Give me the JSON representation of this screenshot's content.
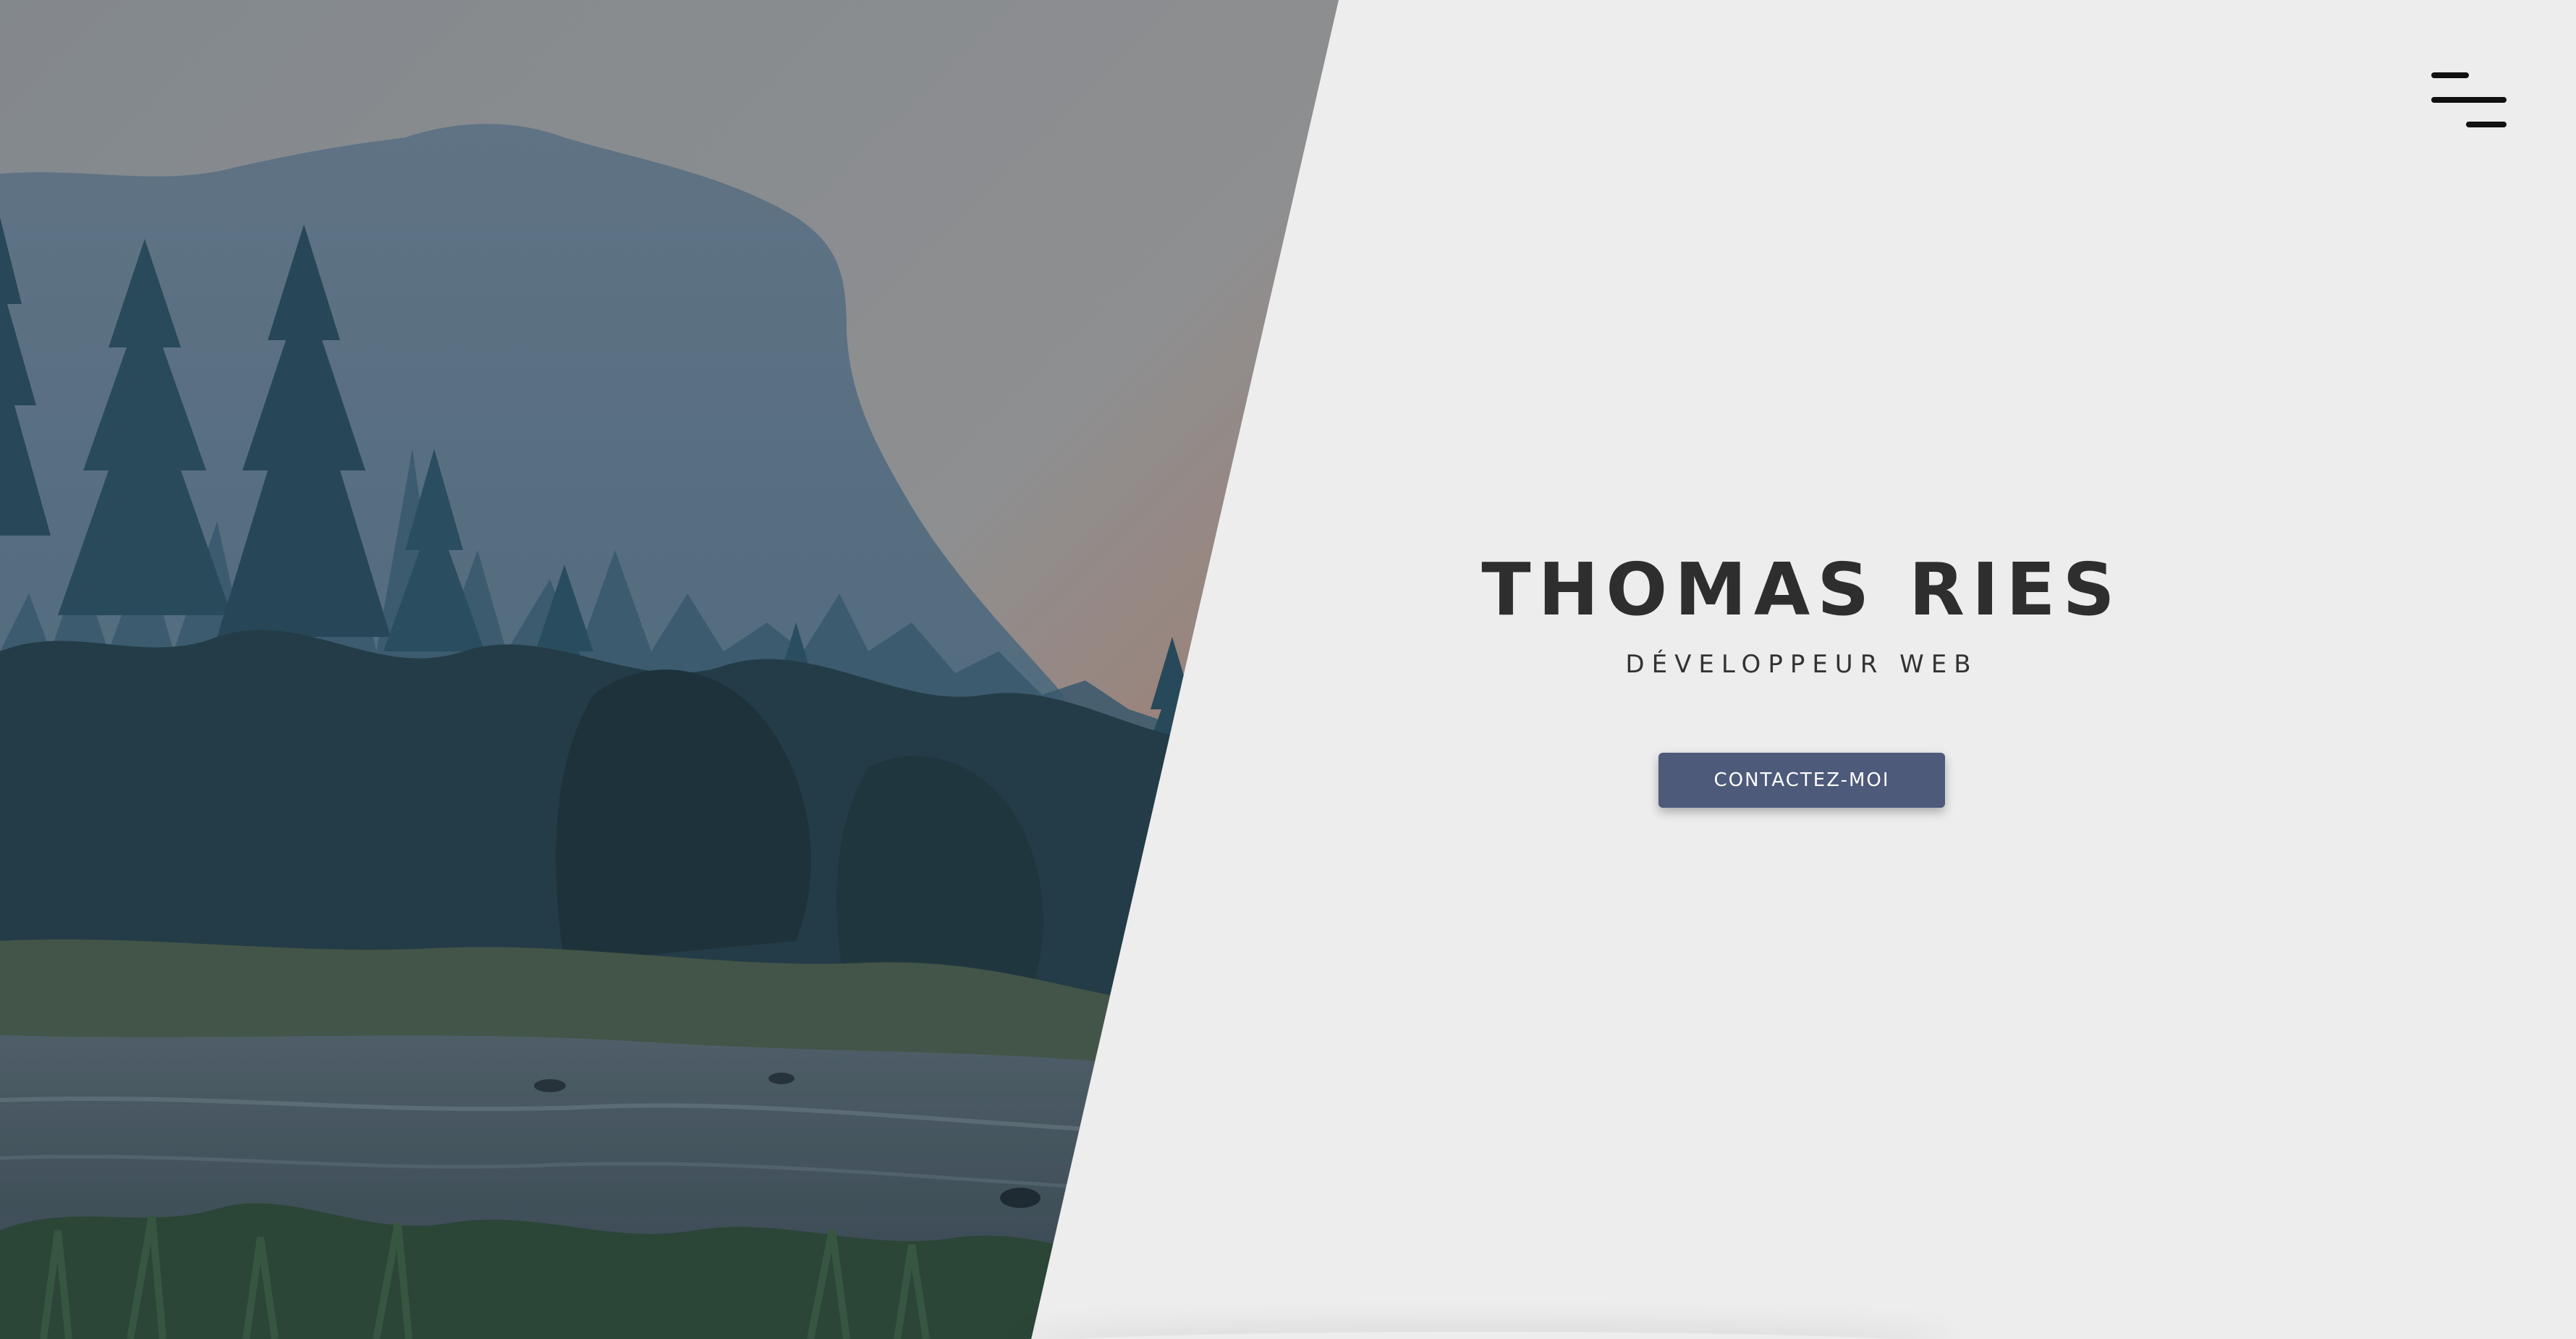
{
  "hero": {
    "name": "THOMAS RIES",
    "subtitle": "DÉVELOPPEUR WEB",
    "cta_label": "CONTACTEZ-MOI"
  },
  "nav": {
    "menu_icon": "hamburger-menu-icon"
  },
  "image": {
    "subject": "mountain-forest-river-landscape"
  },
  "colors": {
    "background": "#ededed",
    "button": "#4d5a7a",
    "button_text": "#ffffff",
    "heading": "#2e2e2e"
  }
}
